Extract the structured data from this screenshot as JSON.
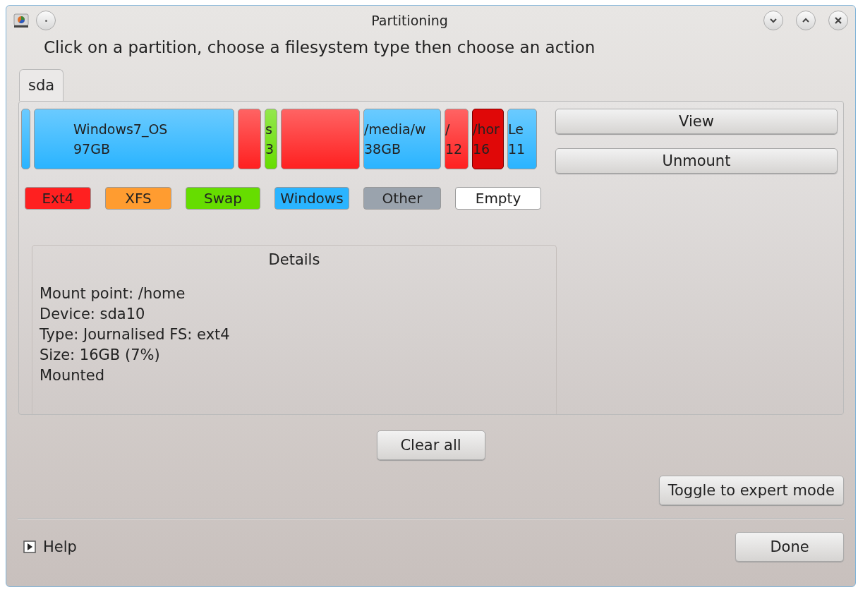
{
  "window": {
    "title": "Partitioning"
  },
  "instruction": "Click on a partition, choose a filesystem type then choose an action",
  "tabs": [
    {
      "label": "sda",
      "selected": true
    }
  ],
  "partitions": [
    {
      "color": "#2ab4ff",
      "selected": false
    },
    {
      "color": "#2ab4ff",
      "lines": [
        "Windows7_OS",
        "97GB"
      ],
      "selected": false
    },
    {
      "color": "#ff2020",
      "selected": false
    },
    {
      "color": "#66dd00",
      "lines": [
        "s",
        "3"
      ],
      "selected": false
    },
    {
      "color": "#ff2020",
      "selected": false
    },
    {
      "color": "#2ab4ff",
      "lines": [
        "/media/w",
        "38GB"
      ],
      "selected": false
    },
    {
      "color": "#ff2020",
      "lines": [
        "/",
        "12"
      ],
      "selected": false
    },
    {
      "color": "#e00808",
      "lines": [
        "/hor",
        "16"
      ],
      "selected": true
    },
    {
      "color": "#2ab4ff",
      "lines": [
        "Le",
        "11"
      ],
      "selected": false
    }
  ],
  "actions": [
    "View",
    "Unmount"
  ],
  "legend": [
    {
      "label": "Ext4",
      "color": "#ff2020"
    },
    {
      "label": "XFS",
      "color": "#ff9c30"
    },
    {
      "label": "Swap",
      "color": "#66dd00"
    },
    {
      "label": "Windows",
      "color": "#2ab4ff"
    },
    {
      "label": "Other",
      "color": "#9aa3ad"
    },
    {
      "label": "Empty",
      "color": "#ffffff"
    }
  ],
  "details": {
    "title": "Details",
    "lines": [
      "Mount point: /home",
      "Device: sda10",
      "Type: Journalised FS: ext4",
      "Size: 16GB (7%)",
      "Mounted"
    ]
  },
  "clear_button": "Clear all",
  "expert_button": "Toggle to expert mode",
  "help": "Help",
  "done_button": "Done"
}
